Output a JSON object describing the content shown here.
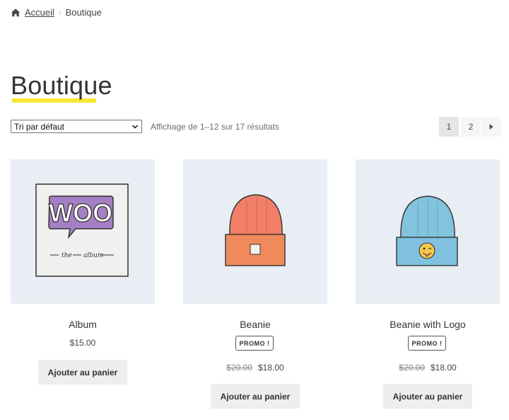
{
  "breadcrumb": {
    "home_label": "Accueil",
    "current": "Boutique"
  },
  "page_title": "Boutique",
  "sort": {
    "selected": "Tri par défaut"
  },
  "result_count": "Affichage de 1–12 sur 17 résultats",
  "pagination": {
    "pages": [
      "1",
      "2"
    ],
    "current": "1",
    "next_icon": "caret-right-icon"
  },
  "products": [
    {
      "name": "Album",
      "price": "$15.00",
      "on_sale": false,
      "button": "Ajouter au panier",
      "image": "woo-album-illustration"
    },
    {
      "name": "Beanie",
      "badge": "PROMO !",
      "old_price": "$20.00",
      "price": "$18.00",
      "on_sale": true,
      "button": "Ajouter au panier",
      "image": "orange-beanie-illustration"
    },
    {
      "name": "Beanie with Logo",
      "badge": "PROMO !",
      "old_price": "$20.00",
      "price": "$18.00",
      "on_sale": true,
      "button": "Ajouter au panier",
      "image": "blue-beanie-logo-illustration"
    }
  ],
  "colors": {
    "highlight": "#f7e733",
    "image_bg": "#e9eef4",
    "button_bg": "#eeeeee"
  }
}
